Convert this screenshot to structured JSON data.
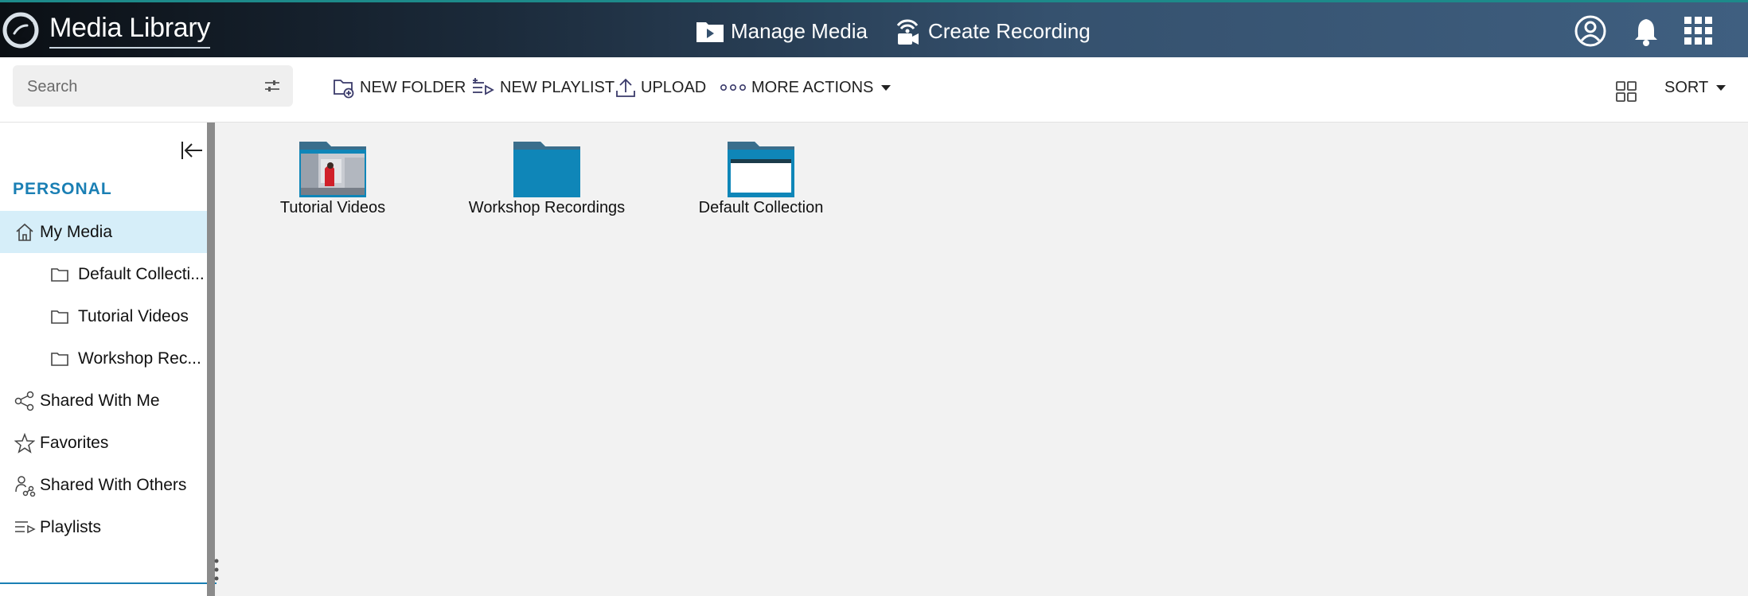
{
  "header": {
    "app_title": "Media Library",
    "nav": [
      {
        "label": "Manage Media",
        "icon": "media-folder-icon"
      },
      {
        "label": "Create Recording",
        "icon": "recording-icon"
      }
    ],
    "icons": [
      "user-avatar-icon",
      "bell-icon",
      "apps-grid-icon"
    ],
    "colors": {
      "header_accent": "#1d8a8a",
      "brand_blue": "#1a7fb4",
      "folder_blue": "#0f86b8"
    }
  },
  "toolbar": {
    "search_placeholder": "Search",
    "new_folder": "NEW FOLDER",
    "new_playlist": "NEW PLAYLIST",
    "upload": "UPLOAD",
    "more_actions": "MORE ACTIONS",
    "sort": "SORT"
  },
  "sidebar": {
    "section": "PERSONAL",
    "items": [
      {
        "label": "My Media",
        "icon": "home-icon",
        "active": true
      },
      {
        "label": "Default Collecti...",
        "icon": "folder-icon"
      },
      {
        "label": "Tutorial Videos",
        "icon": "folder-icon"
      },
      {
        "label": "Workshop Rec...",
        "icon": "folder-icon"
      },
      {
        "label": "Shared With Me",
        "icon": "share-icon"
      },
      {
        "label": "Favorites",
        "icon": "star-icon"
      },
      {
        "label": "Shared With Others",
        "icon": "shared-others-icon"
      },
      {
        "label": "Playlists",
        "icon": "playlist-icon"
      }
    ]
  },
  "folders": [
    {
      "name": "Tutorial Videos",
      "thumbnail": "photo"
    },
    {
      "name": "Workshop Recordings",
      "thumbnail": "none"
    },
    {
      "name": "Default Collection",
      "thumbnail": "document"
    }
  ]
}
